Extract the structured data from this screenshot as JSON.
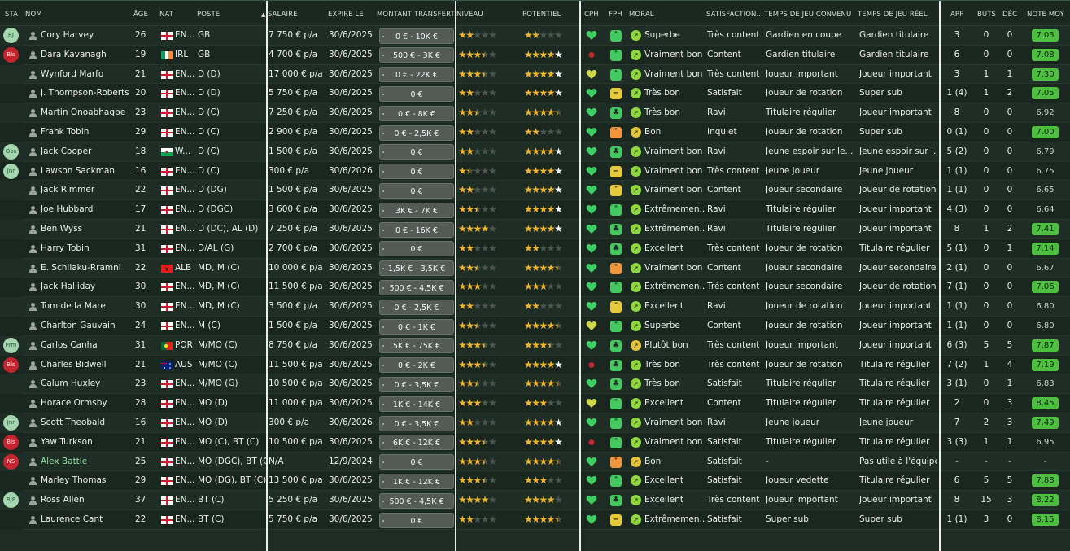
{
  "columns": {
    "sta": "STA",
    "nom": "NOM",
    "age": "ÂGE",
    "nat": "NAT",
    "poste": "POSTE",
    "salaire": "SALAIRE",
    "expire": "EXPIRE LE",
    "transfert": "MONTANT TRANSFERT",
    "niveau": "NIVEAU",
    "potentiel": "POTENTIEL",
    "cph": "CPH",
    "fph": "FPH",
    "moral": "MORAL",
    "satisfaction": "SATISFACTION...",
    "temps_convenu": "TEMPS DE JEU CONVENU",
    "temps_reel": "TEMPS DE JEU RÉEL",
    "app": "APP",
    "buts": "BUTS",
    "dec": "DÉC",
    "note": "NOTE MOY"
  },
  "players": [
    {
      "sta": "RJ",
      "sta_color": "green",
      "name": "Cory Harvey",
      "age": "26",
      "flag": "eng",
      "nat": "EN...",
      "pos": "GB",
      "salary": "7 750 € p/a",
      "expires": "30/6/2025",
      "transfer": "0 € - 10K €",
      "niveau": 2,
      "niveau_half": false,
      "potentiel": 2,
      "potentiel_half": false,
      "pot_white": 0,
      "cph": "heart-green",
      "fph": "up-green",
      "moral_icon": "up",
      "moral": "Superbe",
      "satisfaction": "Très content",
      "convenu": "Gardien en coupe",
      "reel": "Gardien titulaire",
      "app": "3",
      "buts": "0",
      "dec": "0",
      "note": "7.03",
      "note_high": true
    },
    {
      "sta": "Bls",
      "sta_color": "red",
      "name": "Dara Kavanagh",
      "age": "19",
      "flag": "irl",
      "nat": "IRL",
      "pos": "GB",
      "salary": "4 700 € p/a",
      "expires": "30/6/2025",
      "transfer": "500 € - 3K €",
      "niveau": 3,
      "niveau_half": true,
      "potentiel": 4,
      "potentiel_half": false,
      "pot_white": 1,
      "cph": "dot-red",
      "fph": "up-green",
      "moral_icon": "up",
      "moral": "Vraiment bon",
      "satisfaction": "Content",
      "convenu": "Gardien titulaire",
      "reel": "Gardien titulaire",
      "app": "6",
      "buts": "0",
      "dec": "0",
      "note": "7.08",
      "note_high": true
    },
    {
      "sta": "",
      "sta_color": "",
      "name": "Wynford Marfo",
      "age": "21",
      "flag": "eng",
      "nat": "EN...",
      "pos": "D (D)",
      "salary": "17 000 € p/a",
      "expires": "30/6/2025",
      "transfer": "0 € - 22K €",
      "niveau": 3,
      "niveau_half": true,
      "potentiel": 4,
      "potentiel_half": false,
      "pot_white": 1,
      "cph": "heart-yellow",
      "fph": "up-green",
      "moral_icon": "up",
      "moral": "Vraiment bon",
      "satisfaction": "Très content",
      "convenu": "Joueur important",
      "reel": "Joueur important",
      "app": "3",
      "buts": "1",
      "dec": "1",
      "note": "7.30",
      "note_high": true
    },
    {
      "sta": "",
      "sta_color": "",
      "name": "J. Thompson-Roberts",
      "age": "20",
      "flag": "eng",
      "nat": "EN...",
      "pos": "D (D)",
      "salary": "5 750 € p/a",
      "expires": "30/6/2025",
      "transfer": "0 €",
      "niveau": 2,
      "niveau_half": false,
      "potentiel": 4,
      "potentiel_half": false,
      "pot_white": 1,
      "cph": "heart-green",
      "fph": "flat-yellow",
      "moral_icon": "up",
      "moral": "Très bon",
      "satisfaction": "Satisfait",
      "convenu": "Joueur de rotation",
      "reel": "Super sub",
      "app": "1 (4)",
      "buts": "1",
      "dec": "2",
      "note": "7.05",
      "note_high": true
    },
    {
      "sta": "",
      "sta_color": "",
      "name": "Martin Onoabhagbe",
      "age": "23",
      "flag": "eng",
      "nat": "EN...",
      "pos": "D (C)",
      "salary": "7 250 € p/a",
      "expires": "30/6/2025",
      "transfer": "0 € - 8K €",
      "niveau": 2,
      "niveau_half": true,
      "potentiel": 4,
      "potentiel_half": true,
      "pot_white": 0,
      "cph": "heart-green",
      "fph": "club-green",
      "moral_icon": "up",
      "moral": "Très bon",
      "satisfaction": "Ravi",
      "convenu": "Titulaire régulier",
      "reel": "Joueur important",
      "app": "8",
      "buts": "0",
      "dec": "0",
      "note": "6.92",
      "note_high": false
    },
    {
      "sta": "",
      "sta_color": "",
      "name": "Frank Tobin",
      "age": "29",
      "flag": "eng",
      "nat": "EN...",
      "pos": "D (C)",
      "salary": "2 900 € p/a",
      "expires": "30/6/2025",
      "transfer": "0 € - 2,5K €",
      "niveau": 2,
      "niveau_half": false,
      "potentiel": 2,
      "potentiel_half": false,
      "pot_white": 0,
      "cph": "heart-green",
      "fph": "down-orange",
      "moral_icon": "ok",
      "moral": "Bon",
      "satisfaction": "Inquiet",
      "convenu": "Joueur de rotation",
      "reel": "Super sub",
      "app": "0 (1)",
      "buts": "0",
      "dec": "0",
      "note": "7.00",
      "note_high": true
    },
    {
      "sta": "Obs",
      "sta_color": "green",
      "name": "Jack Cooper",
      "age": "18",
      "flag": "wal",
      "nat": "W...",
      "pos": "D (C)",
      "salary": "1 500 € p/a",
      "expires": "30/6/2025",
      "transfer": "0 €",
      "niveau": 2,
      "niveau_half": false,
      "potentiel": 4,
      "potentiel_half": false,
      "pot_white": 1,
      "cph": "heart-green",
      "fph": "club-green",
      "moral_icon": "up",
      "moral": "Vraiment bon",
      "satisfaction": "Ravi",
      "convenu": "Jeune espoir sur le...",
      "reel": "Jeune espoir sur l...",
      "app": "5 (2)",
      "buts": "0",
      "dec": "0",
      "note": "6.79",
      "note_high": false
    },
    {
      "sta": "Jnr",
      "sta_color": "green",
      "name": "Lawson Sackman",
      "age": "16",
      "flag": "eng",
      "nat": "EN...",
      "pos": "D (C)",
      "salary": "300 € p/a",
      "expires": "30/6/2026",
      "transfer": "0 €",
      "niveau": 1,
      "niveau_half": true,
      "potentiel": 4,
      "potentiel_half": false,
      "pot_white": 1,
      "cph": "heart-green",
      "fph": "flat-yellow",
      "moral_icon": "up",
      "moral": "Vraiment bon",
      "satisfaction": "Très content",
      "convenu": "Jeune joueur",
      "reel": "Jeune joueur",
      "app": "1 (1)",
      "buts": "0",
      "dec": "0",
      "note": "6.75",
      "note_high": false
    },
    {
      "sta": "",
      "sta_color": "",
      "name": "Jack Rimmer",
      "age": "22",
      "flag": "eng",
      "nat": "EN...",
      "pos": "D (DG)",
      "salary": "1 500 € p/a",
      "expires": "30/6/2025",
      "transfer": "0 €",
      "niveau": 2,
      "niveau_half": false,
      "potentiel": 4,
      "potentiel_half": false,
      "pot_white": 1,
      "cph": "heart-green",
      "fph": "down-yellow",
      "moral_icon": "up",
      "moral": "Vraiment bon",
      "satisfaction": "Content",
      "convenu": "Joueur secondaire",
      "reel": "Joueur de rotation",
      "app": "1 (1)",
      "buts": "0",
      "dec": "0",
      "note": "6.65",
      "note_high": false
    },
    {
      "sta": "",
      "sta_color": "",
      "name": "Joe Hubbard",
      "age": "17",
      "flag": "eng",
      "nat": "EN...",
      "pos": "D (DGC)",
      "salary": "3 600 € p/a",
      "expires": "30/6/2025",
      "transfer": "3K € - 7K €",
      "niveau": 2,
      "niveau_half": true,
      "potentiel": 4,
      "potentiel_half": false,
      "pot_white": 1,
      "cph": "heart-green",
      "fph": "up-green",
      "moral_icon": "up",
      "moral": "Extrêmemen...",
      "satisfaction": "Ravi",
      "convenu": "Titulaire régulier",
      "reel": "Joueur important",
      "app": "4 (3)",
      "buts": "0",
      "dec": "0",
      "note": "6.64",
      "note_high": false
    },
    {
      "sta": "",
      "sta_color": "",
      "name": "Ben Wyss",
      "age": "21",
      "flag": "eng",
      "nat": "EN...",
      "pos": "D (DC), AL (D)",
      "salary": "7 250 € p/a",
      "expires": "30/6/2025",
      "transfer": "0 € - 16K €",
      "niveau": 4,
      "niveau_half": false,
      "potentiel": 4,
      "potentiel_half": false,
      "pot_white": 1,
      "cph": "heart-green",
      "fph": "club-green",
      "moral_icon": "up",
      "moral": "Extrêmemen...",
      "satisfaction": "Ravi",
      "convenu": "Titulaire régulier",
      "reel": "Joueur important",
      "app": "8",
      "buts": "1",
      "dec": "2",
      "note": "7.41",
      "note_high": true
    },
    {
      "sta": "",
      "sta_color": "",
      "name": "Harry Tobin",
      "age": "31",
      "flag": "eng",
      "nat": "EN...",
      "pos": "D/AL (G)",
      "salary": "2 700 € p/a",
      "expires": "30/6/2025",
      "transfer": "0 €",
      "niveau": 2,
      "niveau_half": false,
      "potentiel": 2,
      "potentiel_half": false,
      "pot_white": 0,
      "cph": "heart-green",
      "fph": "club-green",
      "moral_icon": "up",
      "moral": "Excellent",
      "satisfaction": "Très content",
      "convenu": "Joueur de rotation",
      "reel": "Titulaire régulier",
      "app": "5 (1)",
      "buts": "0",
      "dec": "1",
      "note": "7.14",
      "note_high": true
    },
    {
      "sta": "",
      "sta_color": "",
      "name": "E. Schllaku-Rramni",
      "age": "22",
      "flag": "alb",
      "nat": "ALB",
      "pos": "MD, M (C)",
      "salary": "10 000 € p/a",
      "expires": "30/6/2025",
      "transfer": "1,5K € - 3,5K €",
      "niveau": 2,
      "niveau_half": true,
      "potentiel": 4,
      "potentiel_half": true,
      "pot_white": 0,
      "cph": "heart-green",
      "fph": "down-orange",
      "moral_icon": "up",
      "moral": "Vraiment bon",
      "satisfaction": "Content",
      "convenu": "Joueur secondaire",
      "reel": "Joueur secondaire",
      "app": "2 (1)",
      "buts": "0",
      "dec": "0",
      "note": "6.67",
      "note_high": false
    },
    {
      "sta": "",
      "sta_color": "",
      "name": "Jack Halliday",
      "age": "30",
      "flag": "eng",
      "nat": "EN...",
      "pos": "MD, M (C)",
      "salary": "11 500 € p/a",
      "expires": "30/6/2025",
      "transfer": "500 € - 4,5K €",
      "niveau": 3,
      "niveau_half": false,
      "potentiel": 3,
      "potentiel_half": false,
      "pot_white": 0,
      "cph": "heart-green",
      "fph": "up-green",
      "moral_icon": "up",
      "moral": "Extrêmemen...",
      "satisfaction": "Très content",
      "convenu": "Joueur secondaire",
      "reel": "Joueur de rotation",
      "app": "7 (1)",
      "buts": "0",
      "dec": "0",
      "note": "7.06",
      "note_high": true
    },
    {
      "sta": "",
      "sta_color": "",
      "name": "Tom de la Mare",
      "age": "30",
      "flag": "eng",
      "nat": "EN...",
      "pos": "MD, M (C)",
      "salary": "3 500 € p/a",
      "expires": "30/6/2025",
      "transfer": "0 € - 2,5K €",
      "niveau": 2,
      "niveau_half": false,
      "potentiel": 2,
      "potentiel_half": false,
      "pot_white": 0,
      "cph": "heart-green",
      "fph": "down-yellow",
      "moral_icon": "up",
      "moral": "Excellent",
      "satisfaction": "Ravi",
      "convenu": "Joueur de rotation",
      "reel": "Joueur important",
      "app": "1 (1)",
      "buts": "0",
      "dec": "0",
      "note": "6.80",
      "note_high": false
    },
    {
      "sta": "",
      "sta_color": "",
      "name": "Charlton Gauvain",
      "age": "24",
      "flag": "eng",
      "nat": "EN...",
      "pos": "M (C)",
      "salary": "1 500 € p/a",
      "expires": "30/6/2025",
      "transfer": "0 € - 1K €",
      "niveau": 2,
      "niveau_half": true,
      "potentiel": 4,
      "potentiel_half": true,
      "pot_white": 0,
      "cph": "heart-yellow",
      "fph": "up-green",
      "moral_icon": "up",
      "moral": "Superbe",
      "satisfaction": "Content",
      "convenu": "Joueur de rotation",
      "reel": "Joueur important",
      "app": "1 (1)",
      "buts": "0",
      "dec": "0",
      "note": "6.80",
      "note_high": false
    },
    {
      "sta": "Prm",
      "sta_color": "green",
      "name": "Carlos Canha",
      "age": "31",
      "flag": "por",
      "nat": "POR",
      "pos": "M/MO (C)",
      "salary": "8 750 € p/a",
      "expires": "30/6/2025",
      "transfer": "5K € - 75K €",
      "niveau": 3,
      "niveau_half": true,
      "potentiel": 3,
      "potentiel_half": true,
      "pot_white": 0,
      "cph": "heart-green",
      "fph": "club-green",
      "moral_icon": "ok",
      "moral": "Plutôt bon",
      "satisfaction": "Très content",
      "convenu": "Joueur important",
      "reel": "Joueur important",
      "app": "6 (3)",
      "buts": "5",
      "dec": "5",
      "note": "7.87",
      "note_high": true
    },
    {
      "sta": "Bls",
      "sta_color": "red",
      "name": "Charles Bidwell",
      "age": "21",
      "flag": "aus",
      "nat": "AUS",
      "pos": "M/MO (C)",
      "salary": "11 500 € p/a",
      "expires": "30/6/2025",
      "transfer": "0 € - 2K €",
      "niveau": 3,
      "niveau_half": true,
      "potentiel": 4,
      "potentiel_half": false,
      "pot_white": 1,
      "cph": "dot-red",
      "fph": "club-green",
      "moral_icon": "up",
      "moral": "Très bon",
      "satisfaction": "Très content",
      "convenu": "Joueur de rotation",
      "reel": "Titulaire régulier",
      "app": "7 (2)",
      "buts": "1",
      "dec": "4",
      "note": "7.19",
      "note_high": true
    },
    {
      "sta": "",
      "sta_color": "",
      "name": "Calum Huxley",
      "age": "23",
      "flag": "eng",
      "nat": "EN...",
      "pos": "M/MO (G)",
      "salary": "10 500 € p/a",
      "expires": "30/6/2025",
      "transfer": "0 € - 3,5K €",
      "niveau": 2,
      "niveau_half": true,
      "potentiel": 4,
      "potentiel_half": true,
      "pot_white": 0,
      "cph": "heart-green",
      "fph": "club-green",
      "moral_icon": "up",
      "moral": "Très bon",
      "satisfaction": "Satisfait",
      "convenu": "Titulaire régulier",
      "reel": "Titulaire régulier",
      "app": "3 (1)",
      "buts": "0",
      "dec": "1",
      "note": "6.83",
      "note_high": false
    },
    {
      "sta": "",
      "sta_color": "",
      "name": "Horace Ormsby",
      "age": "28",
      "flag": "eng",
      "nat": "EN...",
      "pos": "MO (D)",
      "salary": "11 000 € p/a",
      "expires": "30/6/2025",
      "transfer": "1K € - 14K €",
      "niveau": 3,
      "niveau_half": false,
      "potentiel": 3,
      "potentiel_half": false,
      "pot_white": 0,
      "cph": "heart-yellow",
      "fph": "up-green",
      "moral_icon": "up",
      "moral": "Excellent",
      "satisfaction": "Content",
      "convenu": "Titulaire régulier",
      "reel": "Titulaire régulier",
      "app": "2",
      "buts": "0",
      "dec": "3",
      "note": "8.45",
      "note_high": true
    },
    {
      "sta": "Jnr",
      "sta_color": "green",
      "name": "Scott Theobald",
      "age": "16",
      "flag": "eng",
      "nat": "EN...",
      "pos": "MO (D)",
      "salary": "300 € p/a",
      "expires": "30/6/2026",
      "transfer": "0 € - 3,5K €",
      "niveau": 2,
      "niveau_half": false,
      "potentiel": 4,
      "potentiel_half": false,
      "pot_white": 1,
      "cph": "heart-green",
      "fph": "up-green",
      "moral_icon": "up",
      "moral": "Vraiment bon",
      "satisfaction": "Ravi",
      "convenu": "Jeune joueur",
      "reel": "Jeune joueur",
      "app": "7",
      "buts": "2",
      "dec": "3",
      "note": "7.49",
      "note_high": true
    },
    {
      "sta": "Bls",
      "sta_color": "red",
      "name": "Yaw Turkson",
      "age": "21",
      "flag": "eng",
      "nat": "EN...",
      "pos": "MO (C), BT (C)",
      "salary": "10 500 € p/a",
      "expires": "30/6/2025",
      "transfer": "6K € - 12K €",
      "niveau": 3,
      "niveau_half": true,
      "potentiel": 4,
      "potentiel_half": false,
      "pot_white": 1,
      "cph": "dot-red",
      "fph": "up-green",
      "moral_icon": "up",
      "moral": "Vraiment bon",
      "satisfaction": "Satisfait",
      "convenu": "Titulaire régulier",
      "reel": "Titulaire régulier",
      "app": "3 (3)",
      "buts": "1",
      "dec": "1",
      "note": "6.95",
      "note_high": false
    },
    {
      "sta": "NS",
      "sta_color": "red",
      "name": "Alex Battle",
      "name_special": true,
      "age": "25",
      "flag": "eng",
      "nat": "EN...",
      "pos": "MO (DGC), BT (C)",
      "salary": "N/A",
      "expires": "12/9/2024",
      "transfer": "0 €",
      "niveau": 3,
      "niveau_half": true,
      "potentiel": 4,
      "potentiel_half": true,
      "pot_white": 0,
      "cph": "heart-green",
      "fph": "down-orange",
      "moral_icon": "ok",
      "moral": "Bon",
      "satisfaction": "Satisfait",
      "convenu": "-",
      "reel": "Pas utile à l'équipe",
      "app": "-",
      "buts": "-",
      "dec": "-",
      "note": "-",
      "note_high": false
    },
    {
      "sta": "",
      "sta_color": "",
      "name": "Marley Thomas",
      "age": "29",
      "flag": "eng",
      "nat": "EN...",
      "pos": "MO (DG), BT (C)",
      "salary": "13 500 € p/a",
      "expires": "30/6/2025",
      "transfer": "1K € - 12K €",
      "niveau": 3,
      "niveau_half": true,
      "potentiel": 3,
      "potentiel_half": false,
      "pot_white": 0,
      "cph": "heart-green",
      "fph": "up-green",
      "moral_icon": "up",
      "moral": "Excellent",
      "satisfaction": "Satisfait",
      "convenu": "Joueur vedette",
      "reel": "Titulaire régulier",
      "app": "6",
      "buts": "5",
      "dec": "5",
      "note": "7.88",
      "note_high": true
    },
    {
      "sta": "RJP",
      "sta_color": "green",
      "name": "Ross Allen",
      "age": "37",
      "flag": "eng",
      "nat": "EN...",
      "pos": "BT (C)",
      "salary": "5 250 € p/a",
      "expires": "30/6/2025",
      "transfer": "500 € - 4,5K €",
      "niveau": 4,
      "niveau_half": false,
      "potentiel": 4,
      "potentiel_half": false,
      "pot_white": 0,
      "cph": "heart-green",
      "fph": "club-green",
      "moral_icon": "up",
      "moral": "Excellent",
      "satisfaction": "Très content",
      "convenu": "Joueur important",
      "reel": "Joueur important",
      "app": "8",
      "buts": "15",
      "dec": "3",
      "note": "8.22",
      "note_high": true
    },
    {
      "sta": "",
      "sta_color": "",
      "name": "Laurence Cant",
      "age": "22",
      "flag": "eng",
      "nat": "EN...",
      "pos": "BT (C)",
      "salary": "5 750 € p/a",
      "expires": "30/6/2025",
      "transfer": "0 €",
      "niveau": 2,
      "niveau_half": false,
      "potentiel": 4,
      "potentiel_half": true,
      "pot_white": 0,
      "cph": "heart-green",
      "fph": "flat-yellow",
      "moral_icon": "up",
      "moral": "Extrêmemen...",
      "satisfaction": "Satisfait",
      "convenu": "Super sub",
      "reel": "Super sub",
      "app": "1 (1)",
      "buts": "3",
      "dec": "0",
      "note": "8.15",
      "note_high": true
    }
  ],
  "colors": {
    "rating_high": "#4dbf3e",
    "star": "#f0b52c",
    "badge_green": "#a4d7b0",
    "badge_red": "#c4252f"
  }
}
